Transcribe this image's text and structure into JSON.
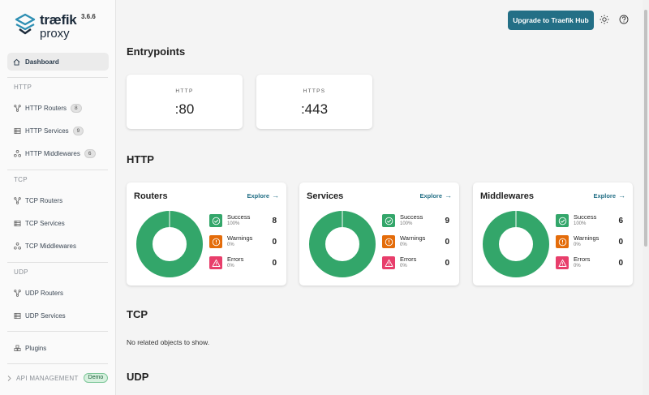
{
  "app": {
    "logo_word": "træfik",
    "logo_sub": "proxy",
    "version": "3.6.6"
  },
  "header": {
    "upgrade_label": "Upgrade to Traefik Hub",
    "theme_icon": "sun-icon",
    "help_icon": "help-circle-icon"
  },
  "sidebar": {
    "dashboard_label": "Dashboard",
    "sections": {
      "http": "HTTP",
      "tcp": "TCP",
      "udp": "UDP"
    },
    "http_items": [
      {
        "label": "HTTP Routers",
        "count": "8",
        "icon": "routers-icon"
      },
      {
        "label": "HTTP Services",
        "count": "9",
        "icon": "services-icon"
      },
      {
        "label": "HTTP Middlewares",
        "count": "6",
        "icon": "middlewares-icon"
      }
    ],
    "tcp_items": [
      {
        "label": "TCP Routers",
        "icon": "routers-icon"
      },
      {
        "label": "TCP Services",
        "icon": "services-icon"
      },
      {
        "label": "TCP Middlewares",
        "icon": "middlewares-icon"
      }
    ],
    "udp_items": [
      {
        "label": "UDP Routers",
        "icon": "routers-icon"
      },
      {
        "label": "UDP Services",
        "icon": "services-icon"
      }
    ],
    "plugins_label": "Plugins",
    "api_management_label": "API MANAGEMENT",
    "api_management_badge": "Demo"
  },
  "main": {
    "entrypoints_title": "Entrypoints",
    "entrypoints": [
      {
        "name": "HTTP",
        "port": ":80"
      },
      {
        "name": "HTTPS",
        "port": ":443"
      }
    ],
    "http_title": "HTTP",
    "explore_label": "Explore",
    "cards": [
      {
        "title": "Routers",
        "success": {
          "label": "Success",
          "pct": "100%",
          "value": "8"
        },
        "warnings": {
          "label": "Warnings",
          "pct": "0%",
          "value": "0"
        },
        "errors": {
          "label": "Errors",
          "pct": "0%",
          "value": "0"
        }
      },
      {
        "title": "Services",
        "success": {
          "label": "Success",
          "pct": "100%",
          "value": "9"
        },
        "warnings": {
          "label": "Warnings",
          "pct": "0%",
          "value": "0"
        },
        "errors": {
          "label": "Errors",
          "pct": "0%",
          "value": "0"
        }
      },
      {
        "title": "Middlewares",
        "success": {
          "label": "Success",
          "pct": "100%",
          "value": "6"
        },
        "warnings": {
          "label": "Warnings",
          "pct": "0%",
          "value": "0"
        },
        "errors": {
          "label": "Errors",
          "pct": "0%",
          "value": "0"
        }
      }
    ],
    "tcp_title": "TCP",
    "tcp_empty": "No related objects to show.",
    "udp_title": "UDP"
  },
  "colors": {
    "success": "#33a66a",
    "warning": "#e46c0a",
    "error": "#e83e6b",
    "accent": "#236f86"
  }
}
